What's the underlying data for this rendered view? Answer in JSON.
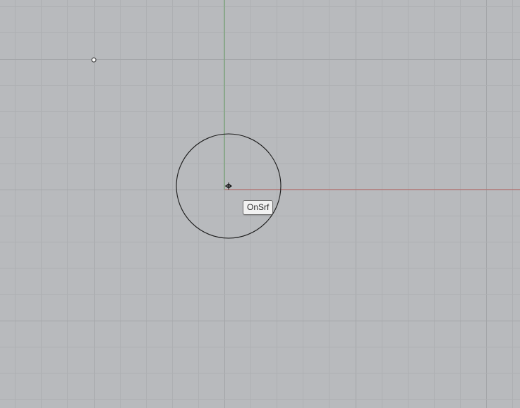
{
  "viewport": {
    "background": "#b8babd",
    "grid_minor_color": "#aeb0b3",
    "grid_major_color": "#a4a6a9",
    "x_axis_color": "#b5716f",
    "y_axis_color": "#79a577",
    "curve_color": "#1b1b1b"
  },
  "osnap_tooltip": {
    "label": "OnSrf"
  },
  "icons": {
    "cursor": "crosshair-icon",
    "point": "point-object-icon"
  }
}
